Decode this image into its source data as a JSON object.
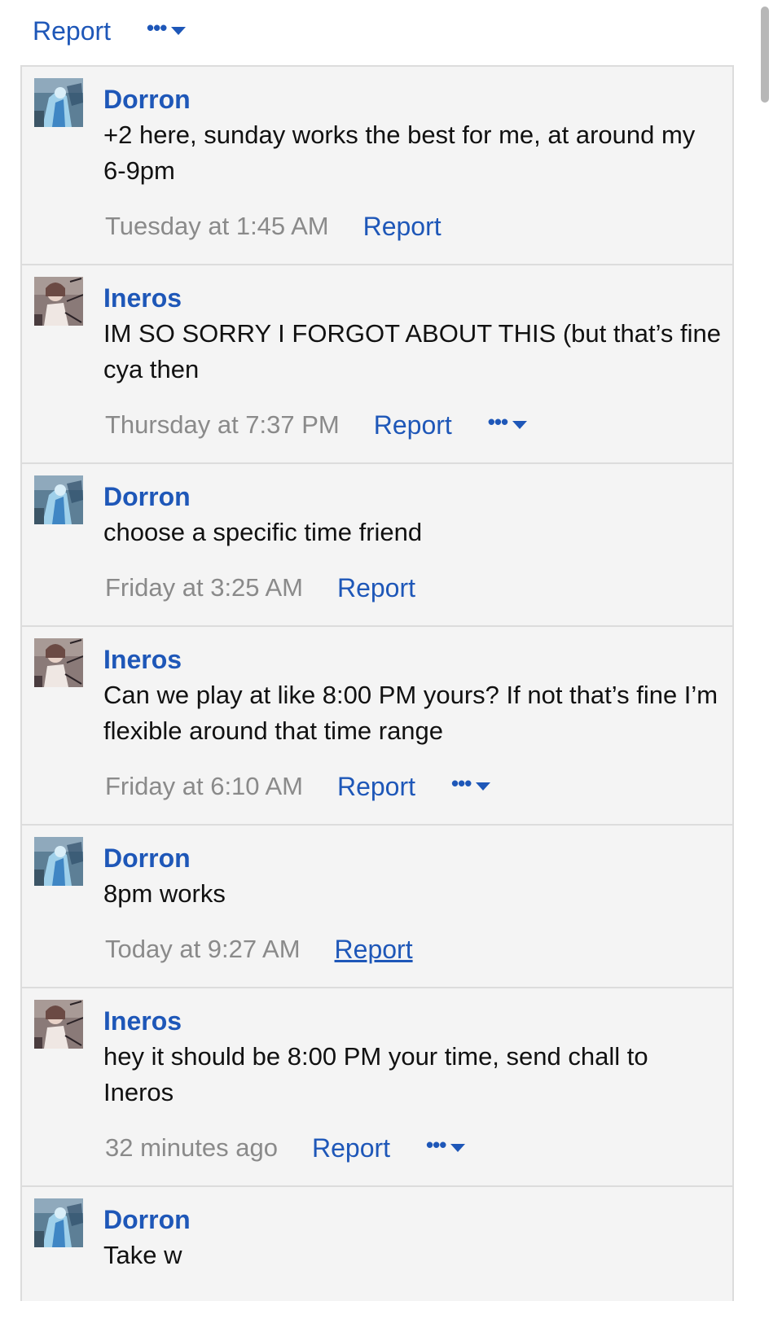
{
  "top_bar": {
    "report_label": "Report",
    "more_label": "•••"
  },
  "comments": [
    {
      "author": "Dorron",
      "text": "+2 here, sunday works the best for me, at around my 6-9pm",
      "timestamp": "Tuesday at 1:45 AM",
      "report_label": "Report",
      "has_more_menu": false
    },
    {
      "author": "Ineros",
      "text": "IM SO SORRY I FORGOT ABOUT THIS (but that’s fine cya then",
      "timestamp": "Thursday at 7:37 PM",
      "report_label": "Report",
      "more_label": "•••",
      "has_more_menu": true
    },
    {
      "author": "Dorron",
      "text": "choose a specific time friend",
      "timestamp": "Friday at 3:25 AM",
      "report_label": "Report",
      "has_more_menu": false
    },
    {
      "author": "Ineros",
      "text": "Can we play at like 8:00 PM yours? If not that’s fine I’m flexible around that time range",
      "timestamp": "Friday at 6:10 AM",
      "report_label": "Report",
      "more_label": "•••",
      "has_more_menu": true
    },
    {
      "author": "Dorron",
      "text": "8pm works",
      "timestamp": "Today at 9:27 AM",
      "report_label": "Report",
      "report_underlined": true,
      "has_more_menu": false
    },
    {
      "author": "Ineros",
      "text": "hey it should be 8:00 PM your time, send chall to Ineros",
      "timestamp": "32 minutes ago",
      "report_label": "Report",
      "more_label": "•••",
      "has_more_menu": true
    },
    {
      "author": "Dorron",
      "text": "Take w"
    }
  ],
  "colors": {
    "link": "#1e57b8",
    "timestamp": "#8a8a8a",
    "comment_bg": "#f4f4f4",
    "border": "#dcdcdc"
  }
}
